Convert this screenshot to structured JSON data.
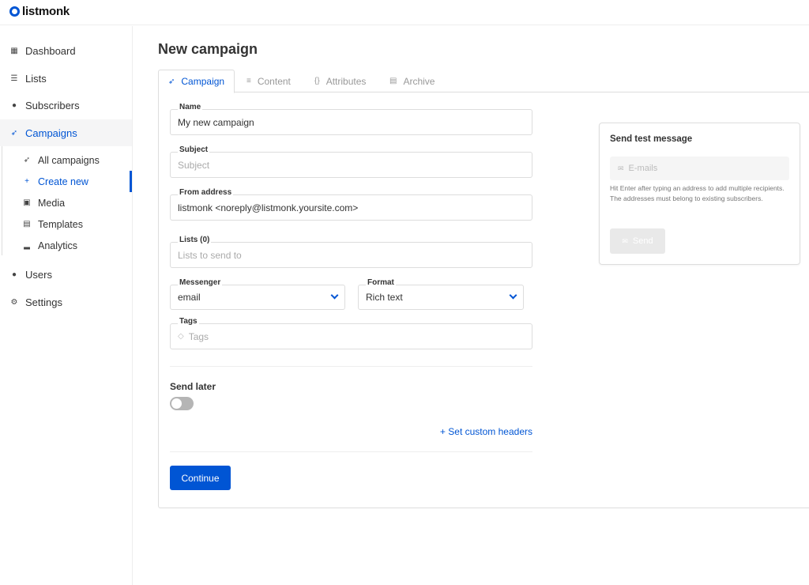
{
  "app": {
    "logo_text": "listmonk"
  },
  "sidebar": {
    "items": [
      {
        "label": "Dashboard",
        "icon": "grid-icon"
      },
      {
        "label": "Lists",
        "icon": "list-icon"
      },
      {
        "label": "Subscribers",
        "icon": "users-icon"
      },
      {
        "label": "Campaigns",
        "icon": "rocket-icon"
      },
      {
        "label": "Users",
        "icon": "users-icon"
      },
      {
        "label": "Settings",
        "icon": "gear-icon"
      }
    ],
    "campaigns_sub": [
      {
        "label": "All campaigns",
        "icon": "rocket-icon"
      },
      {
        "label": "Create new",
        "icon": "plus-icon"
      },
      {
        "label": "Media",
        "icon": "image-icon"
      },
      {
        "label": "Templates",
        "icon": "file-icon"
      },
      {
        "label": "Analytics",
        "icon": "chart-icon"
      }
    ]
  },
  "page": {
    "title": "New campaign"
  },
  "tabs": [
    {
      "label": "Campaign",
      "icon": "rocket-icon",
      "active": true
    },
    {
      "label": "Content",
      "icon": "text-lines-icon"
    },
    {
      "label": "Attributes",
      "icon": "braces-icon"
    },
    {
      "label": "Archive",
      "icon": "archive-icon"
    }
  ],
  "form": {
    "name": {
      "label": "Name",
      "value": "My new campaign"
    },
    "subject": {
      "label": "Subject",
      "placeholder": "Subject"
    },
    "from": {
      "label": "From address",
      "value": "listmonk <noreply@listmonk.yoursite.com>"
    },
    "lists": {
      "label": "Lists (0)",
      "placeholder": "Lists to send to"
    },
    "messenger": {
      "label": "Messenger",
      "value": "email"
    },
    "format": {
      "label": "Format",
      "value": "Rich text"
    },
    "tags": {
      "label": "Tags",
      "placeholder": "Tags"
    },
    "send_later": {
      "label": "Send later",
      "enabled": false
    },
    "custom_headers_label": "+ Set custom headers",
    "continue_label": "Continue"
  },
  "test": {
    "title": "Send test message",
    "emails_placeholder": "E-mails",
    "help": "Hit Enter after typing an address to add multiple recipients. The addresses must belong to existing subscribers.",
    "send_label": "Send"
  },
  "colors": {
    "accent": "#0055d4",
    "border": "#dddddd",
    "muted": "#999999"
  }
}
